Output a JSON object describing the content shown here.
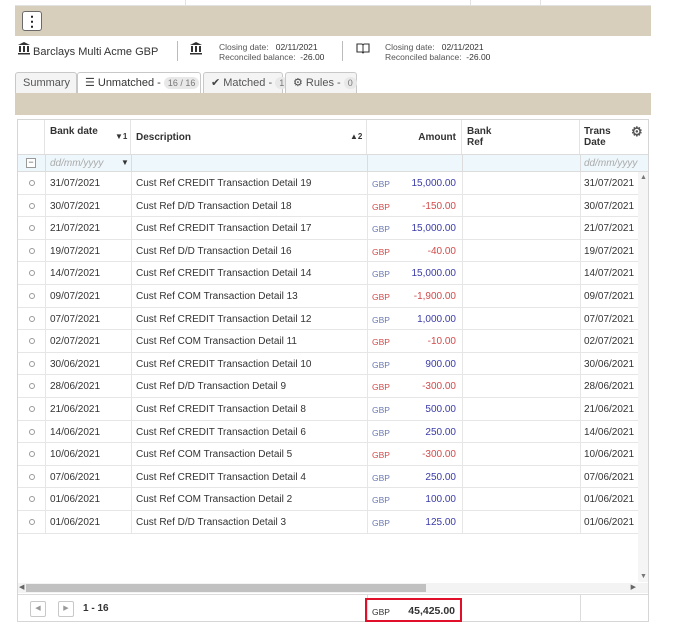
{
  "toolbar": {
    "menu_glyph": "⋮"
  },
  "account": {
    "name": "Barclays Multi Acme GBP",
    "stat1": {
      "closing_label": "Closing date:",
      "closing_value": "02/11/2021",
      "reconciled_label": "Reconciled balance:",
      "reconciled_value": "-26.00"
    },
    "stat2": {
      "closing_label": "Closing date:",
      "closing_value": "02/11/2021",
      "reconciled_label": "Reconciled balance:",
      "reconciled_value": "-26.00"
    }
  },
  "tabs": {
    "summary": "Summary",
    "unmatched": {
      "label": "Unmatched - ",
      "count": "16 / 16"
    },
    "matched": {
      "label": "Matched - ",
      "count": "1"
    },
    "rules": {
      "label": "Rules - ",
      "count": "0"
    }
  },
  "columns": {
    "bank_date": "Bank date",
    "bank_date_sort": "▼1",
    "description": "Description",
    "description_sort": "▲2",
    "amount": "Amount",
    "bank_ref": "Bank Ref",
    "trans_date": "Trans Date"
  },
  "filter": {
    "date_placeholder": "dd/mm/yyyy",
    "trans_placeholder": "dd/mm/yyyy"
  },
  "rows": [
    {
      "bank_date": "31/07/2021",
      "description": "Cust Ref CREDIT Transaction Detail 19",
      "currency": "GBP",
      "amount": "15,000.00",
      "trans_date": "31/07/2021",
      "sign": "pos"
    },
    {
      "bank_date": "30/07/2021",
      "description": "Cust Ref D/D Transaction Detail 18",
      "currency": "GBP",
      "amount": "-150.00",
      "trans_date": "30/07/2021",
      "sign": "neg"
    },
    {
      "bank_date": "21/07/2021",
      "description": "Cust Ref CREDIT Transaction Detail 17",
      "currency": "GBP",
      "amount": "15,000.00",
      "trans_date": "21/07/2021",
      "sign": "pos"
    },
    {
      "bank_date": "19/07/2021",
      "description": "Cust Ref D/D Transaction Detail 16",
      "currency": "GBP",
      "amount": "-40.00",
      "trans_date": "19/07/2021",
      "sign": "neg"
    },
    {
      "bank_date": "14/07/2021",
      "description": "Cust Ref CREDIT Transaction Detail 14",
      "currency": "GBP",
      "amount": "15,000.00",
      "trans_date": "14/07/2021",
      "sign": "pos"
    },
    {
      "bank_date": "09/07/2021",
      "description": "Cust Ref COM Transaction Detail 13",
      "currency": "GBP",
      "amount": "-1,900.00",
      "trans_date": "09/07/2021",
      "sign": "neg"
    },
    {
      "bank_date": "07/07/2021",
      "description": "Cust Ref CREDIT Transaction Detail 12",
      "currency": "GBP",
      "amount": "1,000.00",
      "trans_date": "07/07/2021",
      "sign": "pos"
    },
    {
      "bank_date": "02/07/2021",
      "description": "Cust Ref COM Transaction Detail 11",
      "currency": "GBP",
      "amount": "-10.00",
      "trans_date": "02/07/2021",
      "sign": "neg"
    },
    {
      "bank_date": "30/06/2021",
      "description": "Cust Ref CREDIT Transaction Detail 10",
      "currency": "GBP",
      "amount": "900.00",
      "trans_date": "30/06/2021",
      "sign": "pos"
    },
    {
      "bank_date": "28/06/2021",
      "description": "Cust Ref D/D Transaction Detail 9",
      "currency": "GBP",
      "amount": "-300.00",
      "trans_date": "28/06/2021",
      "sign": "neg"
    },
    {
      "bank_date": "21/06/2021",
      "description": "Cust Ref CREDIT Transaction Detail 8",
      "currency": "GBP",
      "amount": "500.00",
      "trans_date": "21/06/2021",
      "sign": "pos"
    },
    {
      "bank_date": "14/06/2021",
      "description": "Cust Ref CREDIT Transaction Detail 6",
      "currency": "GBP",
      "amount": "250.00",
      "trans_date": "14/06/2021",
      "sign": "pos"
    },
    {
      "bank_date": "10/06/2021",
      "description": "Cust Ref COM Transaction Detail 5",
      "currency": "GBP",
      "amount": "-300.00",
      "trans_date": "10/06/2021",
      "sign": "neg"
    },
    {
      "bank_date": "07/06/2021",
      "description": "Cust Ref CREDIT Transaction Detail 4",
      "currency": "GBP",
      "amount": "250.00",
      "trans_date": "07/06/2021",
      "sign": "pos"
    },
    {
      "bank_date": "01/06/2021",
      "description": "Cust Ref COM Transaction Detail 2",
      "currency": "GBP",
      "amount": "100.00",
      "trans_date": "01/06/2021",
      "sign": "pos"
    },
    {
      "bank_date": "01/06/2021",
      "description": "Cust Ref D/D Transaction Detail 3",
      "currency": "GBP",
      "amount": "125.00",
      "trans_date": "01/06/2021",
      "sign": "pos"
    }
  ],
  "footer": {
    "page_info": "1 - 16",
    "total_currency": "GBP",
    "total_amount": "45,425.00"
  },
  "colors": {
    "toolbar_bg": "#d7cfbb",
    "positive": "#3a3aa8",
    "negative": "#d24a4a",
    "highlight": "#e0102a"
  }
}
